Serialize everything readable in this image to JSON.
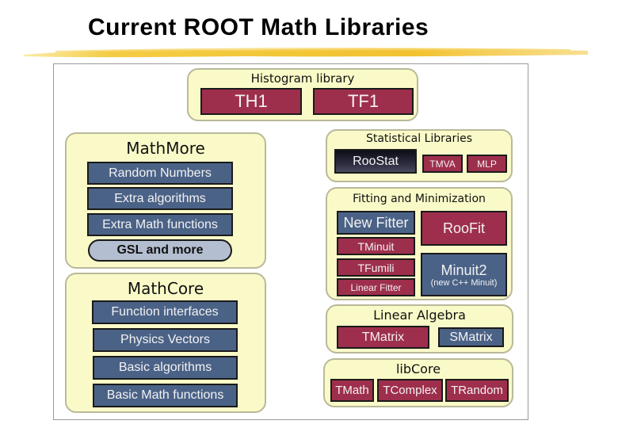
{
  "slide": {
    "title": "Current ROOT Math Libraries"
  },
  "colors": {
    "panel_bg": "#fafac8",
    "red_box": "#9e2f4c",
    "blue_box": "#4b6287",
    "dark_box": "#1c1c2a",
    "pill": "#b3bfd0",
    "brush": "#f2c230"
  },
  "histogram": {
    "title": "Histogram library",
    "items": [
      "TH1",
      "TF1"
    ]
  },
  "mathmore": {
    "title": "MathMore",
    "items": [
      "Random Numbers",
      "Extra algorithms",
      "Extra Math functions"
    ],
    "pill": "GSL and more"
  },
  "mathcore": {
    "title": "MathCore",
    "items": [
      "Function interfaces",
      "Physics Vectors",
      "Basic algorithms",
      "Basic Math functions"
    ]
  },
  "statistical": {
    "title": "Statistical Libraries",
    "items": [
      "RooStat",
      "TMVA",
      "MLP"
    ]
  },
  "fitting": {
    "title": "Fitting and Minimization",
    "new_fitter": "New Fitter",
    "tminuit": "TMinuit",
    "tfumili": "TFumili",
    "linear_fitter": "Linear Fitter",
    "roofit": "RooFit",
    "minuit2": "Minuit2",
    "minuit2_sub": "(new C++ Minuit)"
  },
  "linear_algebra": {
    "title": "Linear Algebra",
    "items": [
      "TMatrix",
      "SMatrix"
    ]
  },
  "libcore": {
    "title": "libCore",
    "items": [
      "TMath",
      "TComplex",
      "TRandom"
    ]
  }
}
